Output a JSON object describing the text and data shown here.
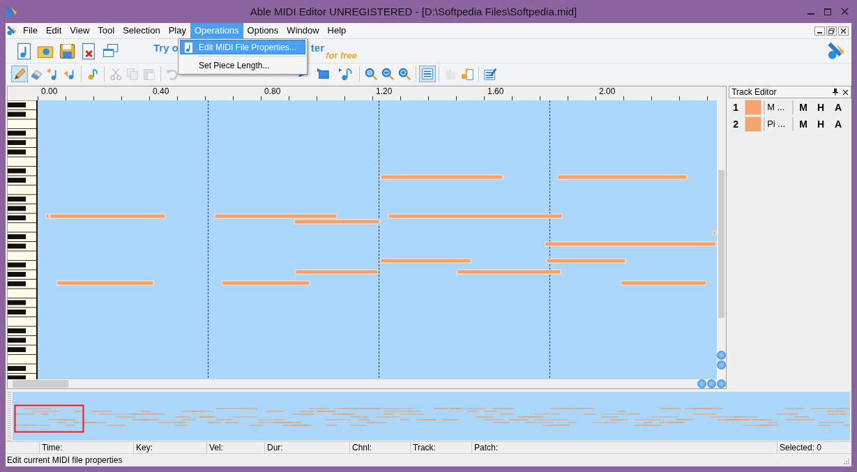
{
  "window": {
    "title": "Able MIDI Editor UNREGISTERED - [D:\\Softpedia Files\\Softpedia.mid]"
  },
  "menu": [
    {
      "label": "File",
      "selected": false
    },
    {
      "label": "Edit",
      "selected": false
    },
    {
      "label": "View",
      "selected": false
    },
    {
      "label": "Tool",
      "selected": false
    },
    {
      "label": "Selection",
      "selected": false
    },
    {
      "label": "Play",
      "selected": false
    },
    {
      "label": "Operations",
      "selected": true
    },
    {
      "label": "Options",
      "selected": false
    },
    {
      "label": "Window",
      "selected": false
    },
    {
      "label": "Help",
      "selected": false
    }
  ],
  "dropdown": {
    "items": [
      {
        "label": "Edit MIDI File Properties...",
        "selected": true
      },
      {
        "label": "Set Piece Length...",
        "selected": false
      }
    ]
  },
  "banner": {
    "text_left": "Try o",
    "text_right": "ter",
    "subtitle": "for free"
  },
  "tools": [
    {
      "selected": true,
      "disabled": false
    },
    {
      "selected": false,
      "disabled": false
    },
    {
      "selected": false,
      "disabled": false
    },
    {
      "selected": false,
      "disabled": false
    },
    {
      "selected": false,
      "disabled": false
    },
    {
      "selected": false,
      "disabled": true
    },
    {
      "selected": false,
      "disabled": true
    },
    {
      "selected": false,
      "disabled": true
    },
    {
      "selected": false,
      "disabled": true
    },
    {
      "selected": false,
      "disabled": false
    },
    {
      "selected": false,
      "disabled": false
    },
    {
      "selected": false,
      "disabled": false
    },
    {
      "selected": false,
      "disabled": false
    },
    {
      "selected": false,
      "disabled": false
    },
    {
      "selected": false,
      "disabled": false
    },
    {
      "selected": true,
      "disabled": false
    },
    {
      "selected": false,
      "disabled": true
    },
    {
      "selected": false,
      "disabled": false
    },
    {
      "selected": false,
      "disabled": false
    }
  ],
  "ruler": [
    "0.00",
    "0.40",
    "0.80",
    "1.20",
    "1.60",
    "2.00"
  ],
  "track_editor": {
    "title": "Track Editor",
    "tracks": [
      {
        "number": "1",
        "name": "M ...",
        "color": "#fba36e",
        "buttons": [
          "M",
          "H",
          "A"
        ]
      },
      {
        "number": "2",
        "name": "Pi ...",
        "color": "#fba36e",
        "buttons": [
          "M",
          "H",
          "A"
        ]
      }
    ]
  },
  "status_fields": [
    "Time:",
    "Key:",
    "Vel:",
    "Dur:",
    "Chnl:",
    "Track:",
    "Patch:",
    "Selected: 0"
  ],
  "status_bar": "Edit current MIDI file properties"
}
